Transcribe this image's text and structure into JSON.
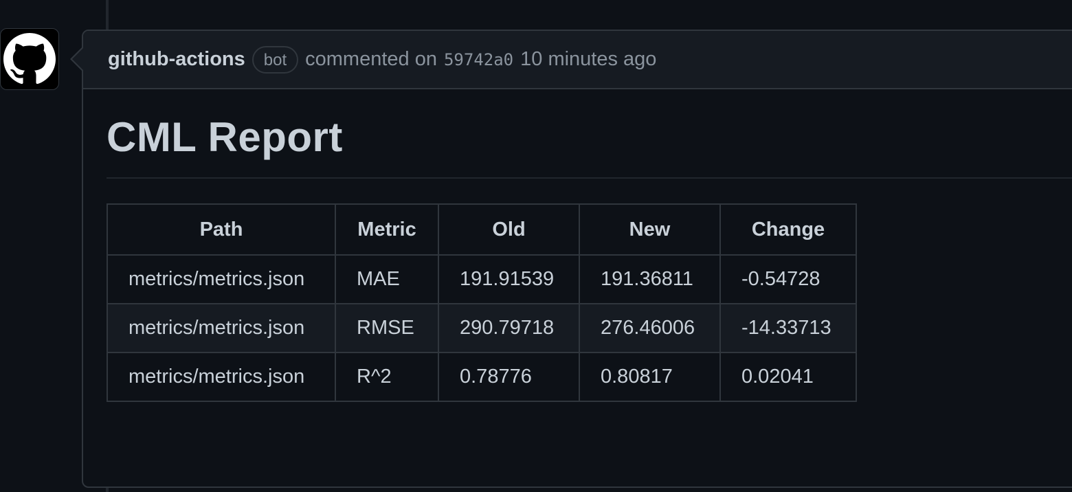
{
  "comment": {
    "author": "github-actions",
    "badge": "bot",
    "action": "commented on",
    "commit_sha": "59742a0",
    "timestamp": "10 minutes ago"
  },
  "report": {
    "title": "CML Report",
    "columns": [
      "Path",
      "Metric",
      "Old",
      "New",
      "Change"
    ],
    "rows": [
      [
        "metrics/metrics.json",
        "MAE",
        "191.91539",
        "191.36811",
        "-0.54728"
      ],
      [
        "metrics/metrics.json",
        "RMSE",
        "290.79718",
        "276.46006",
        "-14.33713"
      ],
      [
        "metrics/metrics.json",
        "R^2",
        "0.78776",
        "0.80817",
        "0.02041"
      ]
    ]
  },
  "icons": {
    "avatar": "github-octocat-icon"
  },
  "colors": {
    "background": "#0d1117",
    "header_background": "#161b22",
    "border": "#30363d",
    "text": "#c9d1d9",
    "muted_text": "#8b949e"
  }
}
